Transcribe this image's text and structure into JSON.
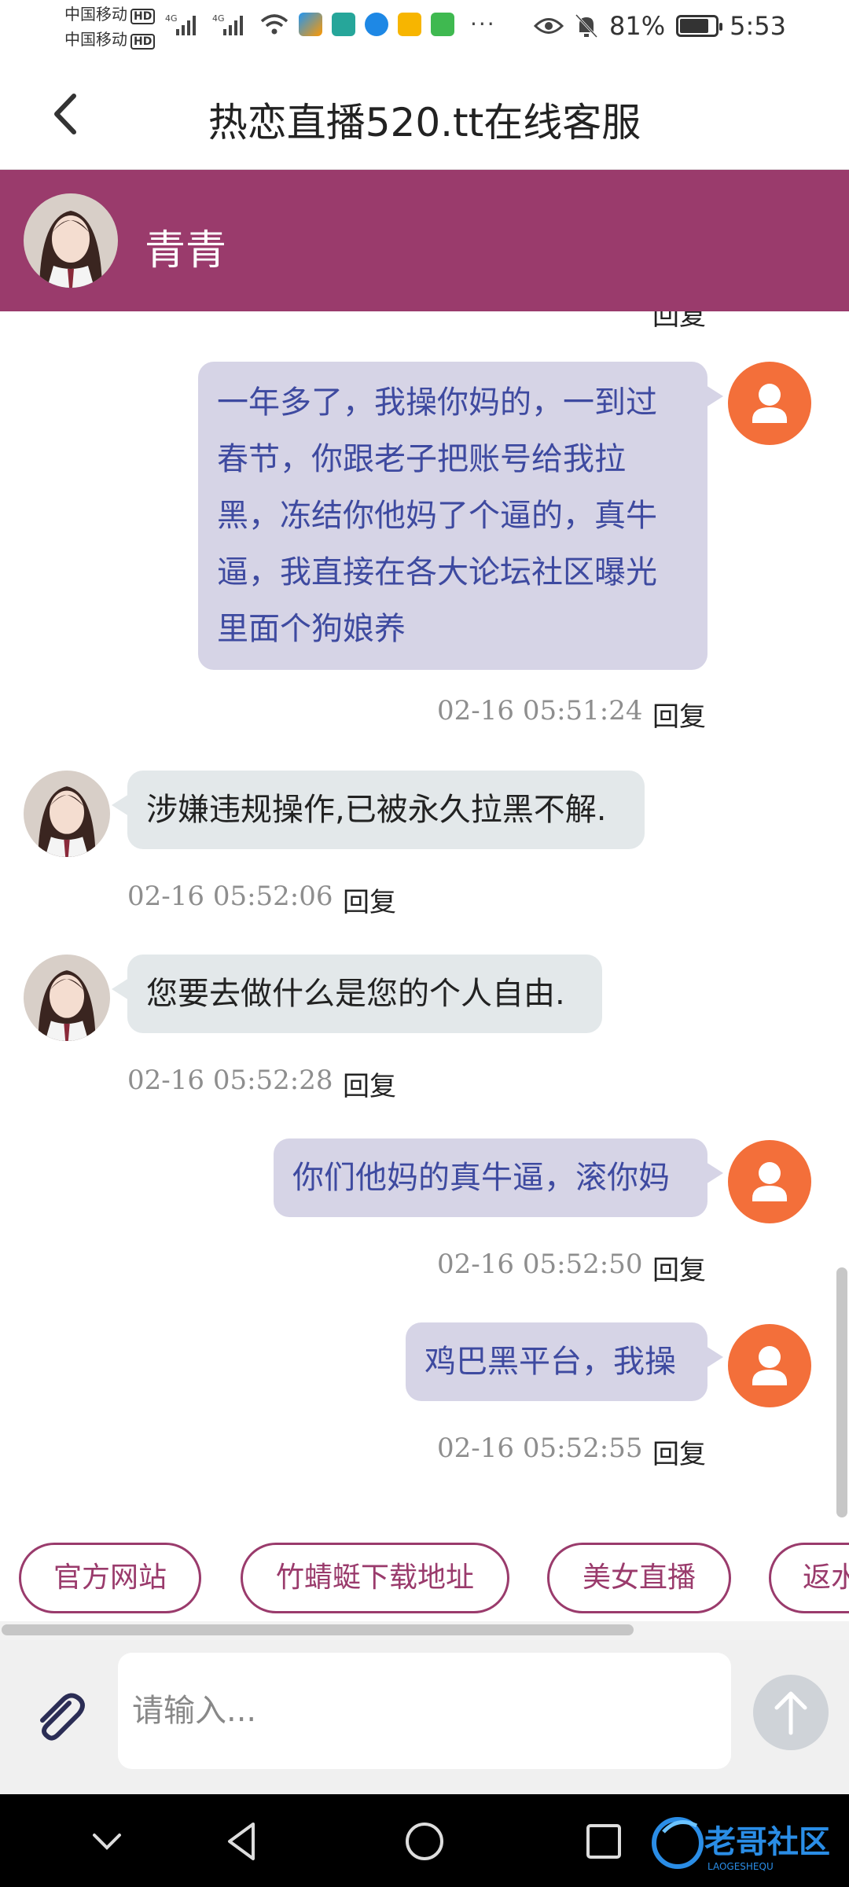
{
  "status_bar": {
    "carrier_1": "中国移动",
    "carrier_2": "中国移动",
    "hd": "HD",
    "battery_percent": "81%",
    "battery_level": 0.81,
    "time": "5:53"
  },
  "header": {
    "title": "热恋直播520.tt在线客服"
  },
  "agent": {
    "name": "青青"
  },
  "chat": {
    "partial_reply": "回复",
    "messages": [
      {
        "from": "user",
        "lines": [
          "一年多了，我操你妈的，一到过",
          "春节，你跟老子把账号给我拉",
          "黑，冻结你他妈了个逼的，真牛",
          "逼，我直接在各大论坛社区曝光",
          "里面个狗娘养"
        ],
        "time": "02-16 05:51:24",
        "reply": "回复"
      },
      {
        "from": "agent",
        "text": "涉嫌违规操作,已被永久拉黑不解.",
        "time": "02-16 05:52:06",
        "reply": "回复"
      },
      {
        "from": "agent",
        "text": "您要去做什么是您的个人自由.",
        "time": "02-16 05:52:28",
        "reply": "回复"
      },
      {
        "from": "user",
        "text": "你们他妈的真牛逼，滚你妈",
        "time": "02-16 05:52:50",
        "reply": "回复"
      },
      {
        "from": "user",
        "text": "鸡巴黑平台，我操",
        "time": "02-16 05:52:55",
        "reply": "回复"
      }
    ]
  },
  "quick_links": [
    "官方网站",
    "竹蜻蜓下载地址",
    "美女直播",
    "返水"
  ],
  "input": {
    "placeholder": "请输入..."
  },
  "watermark": {
    "text": "老哥社区",
    "sub": "LAOGESHEQU"
  },
  "colors": {
    "brand": "#9a3b6c",
    "user_bubble": "#d6d4e6",
    "user_text": "#3e4aa0",
    "agent_bubble": "#e3e8ea",
    "user_avatar": "#f36f3a"
  },
  "icons": {
    "back": "chevron-left-icon",
    "attach": "paperclip-icon",
    "send": "arrow-up-icon",
    "user_avatar": "person-icon"
  }
}
